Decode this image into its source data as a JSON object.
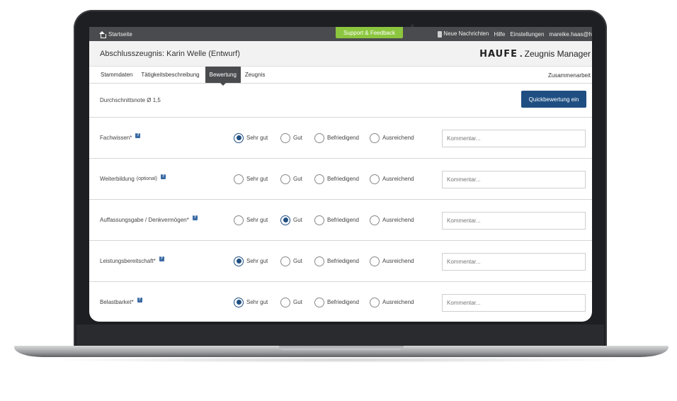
{
  "topbar": {
    "home_label": "Startseite",
    "support_label": "Support & Feedback",
    "messages_label": "Neue Nachrichten",
    "help_label": "Hilfe",
    "settings_label": "Einstellungen",
    "user_label": "mareike.haas@h"
  },
  "header": {
    "title": "Abschlusszeugnis: Karin Welle (Entwurf)",
    "brand_name": "HAUFE",
    "brand_dot": ".",
    "app_name": "Zeugnis Manager"
  },
  "nav": {
    "tabs": [
      {
        "label": "Stammdaten",
        "active": false
      },
      {
        "label": "Tätigkeitsbeschreibung",
        "active": false
      },
      {
        "label": "Bewertung",
        "active": true
      },
      {
        "label": "Zeugnis",
        "active": false
      }
    ],
    "right_label": "Zusammenarbeit"
  },
  "summary": {
    "average_label": "Durchschnittsnote Ø 1,5",
    "quick_button_label": "Quickbewertung ein"
  },
  "rating_options": [
    "Sehr gut",
    "Gut",
    "Befriedigend",
    "Ausreichend"
  ],
  "criteria": [
    {
      "label": "Fachwissen*",
      "optional_suffix": "",
      "selected": 0,
      "comment_placeholder": "Kommentar..."
    },
    {
      "label": "Weiterbildung",
      "optional_suffix": "(optional)",
      "selected": -1,
      "comment_placeholder": "Kommentar..."
    },
    {
      "label": "Auffassungsgabe / Denkvermögen*",
      "optional_suffix": "",
      "selected": 1,
      "comment_placeholder": "Kommentar..."
    },
    {
      "label": "Leistungsbereitschaft*",
      "optional_suffix": "",
      "selected": 0,
      "comment_placeholder": "Kommentar..."
    },
    {
      "label": "Belastbarket*",
      "optional_suffix": "",
      "selected": 0,
      "comment_placeholder": "Kommentar..."
    }
  ],
  "help_glyph": "?",
  "colors": {
    "accent": "#1f4f82",
    "support": "#8cc63e",
    "topbar": "#4a4b4e"
  }
}
